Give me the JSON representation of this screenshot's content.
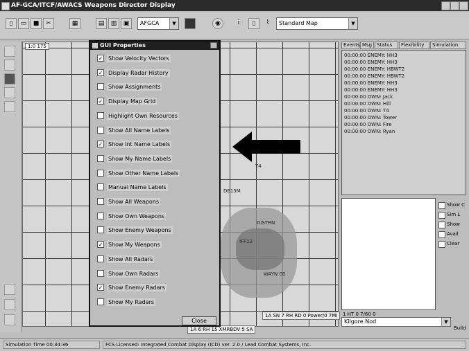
{
  "window": {
    "title": "AF-GCA/ITCF/AWACS Weapons Director Display"
  },
  "toolbar": {
    "mode_combo": "AFGCA",
    "map_combo": "Standard Map"
  },
  "map": {
    "scale_label": "1:0 175",
    "readouts": [
      "1A SN 7 RH RD 0 Power/0 7MI",
      "1A 6 RH 15 XMRBDV 5 SA"
    ],
    "labels": [
      "DE15M",
      "DISTRN",
      "IFF12",
      "WAYN 00",
      "T4"
    ]
  },
  "gui_properties": {
    "title": "GUI Properties",
    "options": [
      {
        "label": "Show Velocity Vectors",
        "checked": true
      },
      {
        "label": "Display Radar History",
        "checked": true
      },
      {
        "label": "Show Assignments",
        "checked": false
      },
      {
        "label": "Display Map Grid",
        "checked": true
      },
      {
        "label": "Highlight Own Resources",
        "checked": false
      },
      {
        "label": "Show All Name Labels",
        "checked": false
      },
      {
        "label": "Show Int Name Labels",
        "checked": true
      },
      {
        "label": "Show My Name Labels",
        "checked": false
      },
      {
        "label": "Show Other Name Labels",
        "checked": false
      },
      {
        "label": "Manual Name Labels",
        "checked": false
      },
      {
        "label": "Show All Weapons",
        "checked": false
      },
      {
        "label": "Show Own Weapons",
        "checked": false
      },
      {
        "label": "Show Enemy Weapons",
        "checked": false
      },
      {
        "label": "Show My Weapons",
        "checked": true
      },
      {
        "label": "Show All Radars",
        "checked": false
      },
      {
        "label": "Show Own Radars",
        "checked": false
      },
      {
        "label": "Show Enemy Radars",
        "checked": true
      },
      {
        "label": "Show My Radars",
        "checked": false
      }
    ],
    "close_label": "Close"
  },
  "right_panel": {
    "tabs": [
      "Events",
      "Msg",
      "Status",
      "Flexibility",
      "Simulation"
    ],
    "events": [
      "00:00:00 ENEMY: HH3",
      "00:00:00 ENEMY: HH3",
      "00:00:00 ENEMY: HBWT2",
      "00:00:00 ENEMY: HBWT2",
      "00:00:00 ENEMY: HH3",
      "00:00:00 ENEMY: HH3",
      "00:00:00 OWN: Jack",
      "00:00:00 OWN: Hill",
      "00:00:00 OWN: T4",
      "00:00:00 OWN: Tower",
      "00:00:00 OWN: Fire",
      "00:00:00 OWN: Ryan"
    ],
    "side_checks": [
      "Show C",
      "Sim L",
      "Show",
      "Avail",
      "Clear"
    ],
    "stat_line": "1 HT 0 7/60 0",
    "stat_combo": "Kilgore Nod",
    "side_button": "Build"
  },
  "status_bar": {
    "sim_time": "Simulation Time 00:34:36",
    "copyright": "FCS Licensed: Integrated Combat Display (ICD) ver. 2.0 / Lead Combat Systems, Inc."
  }
}
